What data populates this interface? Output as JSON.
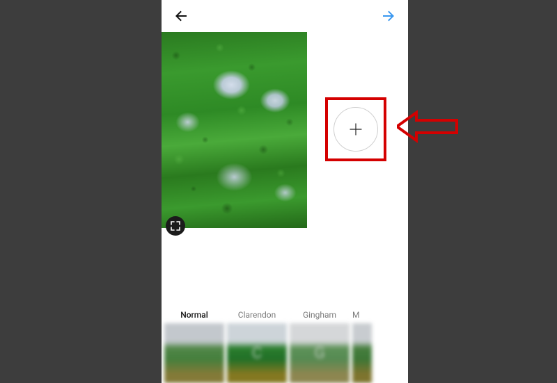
{
  "annotations": {
    "highlight_color": "#d40000",
    "arrow_color": "#d40000"
  },
  "topbar": {
    "back_icon": "back-arrow",
    "next_icon": "next-arrow"
  },
  "photo": {
    "crop_icon": "expand-crop",
    "add_icon": "plus"
  },
  "filters": {
    "items": [
      {
        "label": "Normal",
        "overlay": "",
        "selected": true
      },
      {
        "label": "Clarendon",
        "overlay": "C",
        "selected": false
      },
      {
        "label": "Gingham",
        "overlay": "G",
        "selected": false
      },
      {
        "label": "M",
        "overlay": "",
        "selected": false,
        "partial": true
      }
    ]
  }
}
